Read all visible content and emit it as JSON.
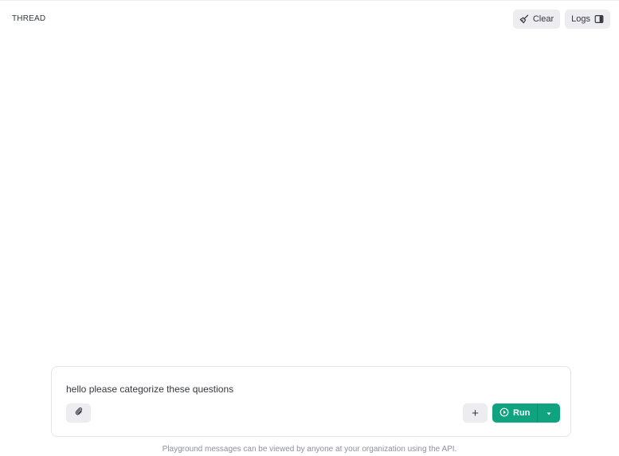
{
  "header": {
    "title": "THREAD",
    "clear_label": "Clear",
    "logs_label": "Logs"
  },
  "composer": {
    "text": "hello please categorize these questions",
    "run_label": "Run",
    "plus_label": "+"
  },
  "footer": {
    "note": "Playground messages can be viewed by anyone at your organization using the API."
  },
  "colors": {
    "accent": "#10a37f",
    "button_bg": "#ececf1"
  }
}
